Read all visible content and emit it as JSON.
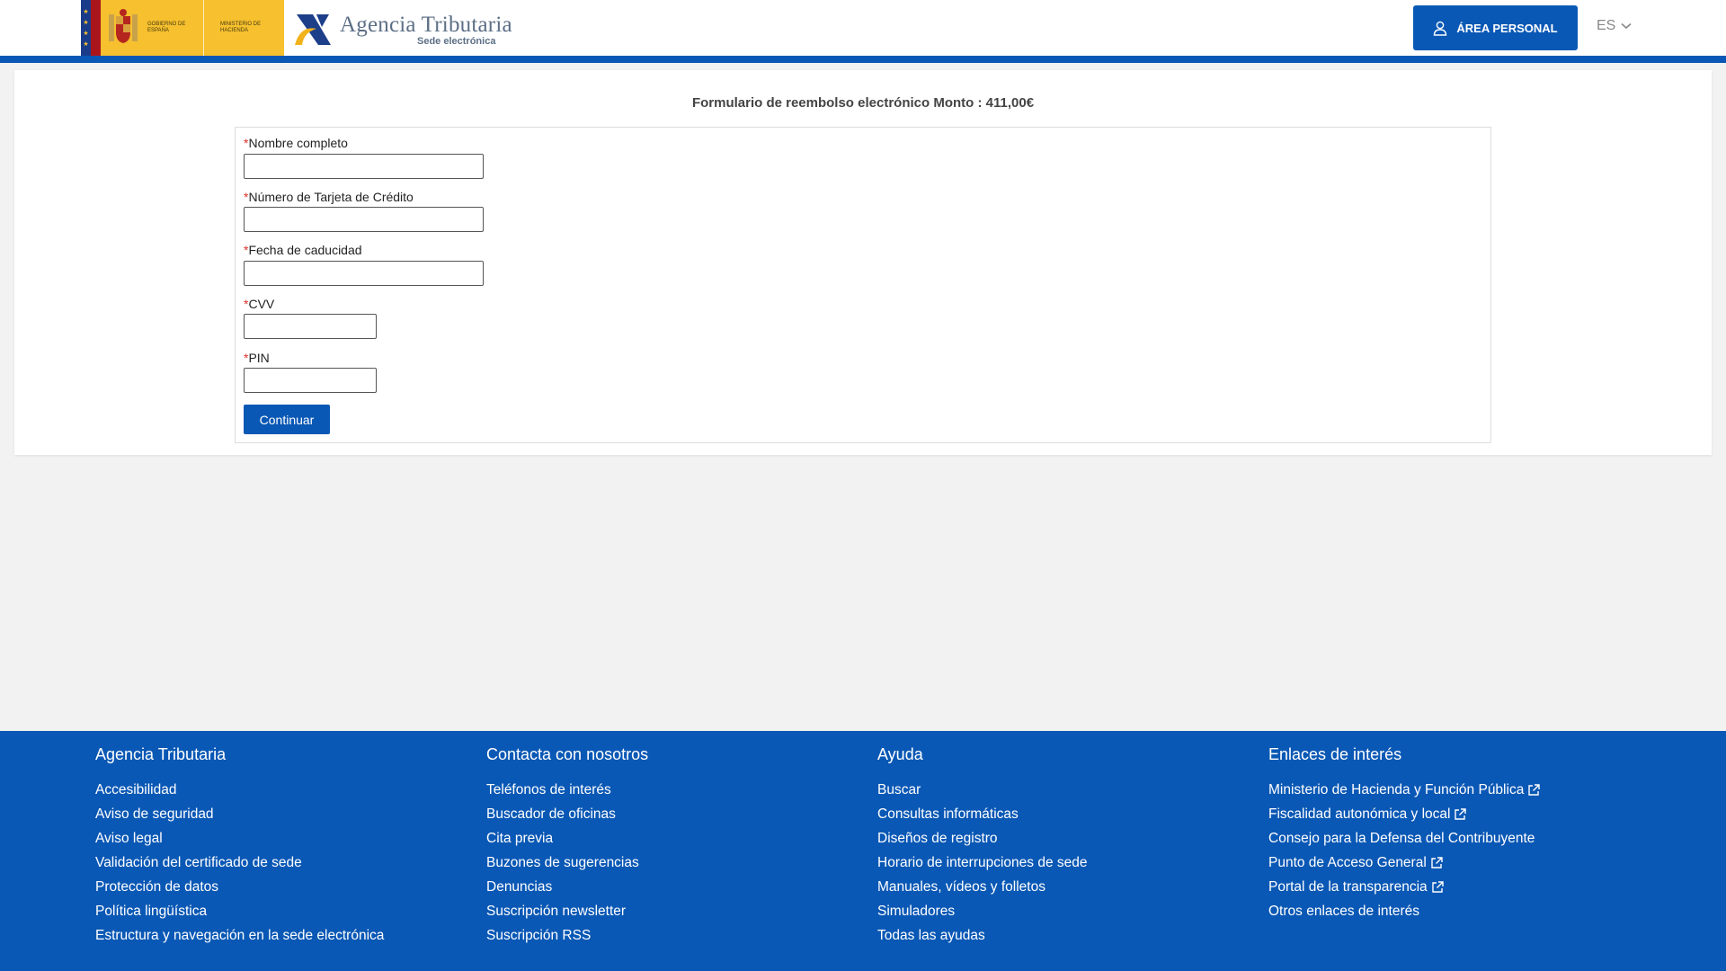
{
  "header": {
    "gobierno_text": "GOBIERNO DE ESPAÑA",
    "ministerio_text": "MINISTERIO DE HACIENDA",
    "agency_name": "Agencia Tributaria",
    "agency_sub": "Sede electrónica",
    "area_personal_label": "ÁREA PERSONAL",
    "language": "ES"
  },
  "form": {
    "title": "Formulario de reembolso electrónico Monto : 411,00€",
    "required_mark": "*",
    "fields": [
      {
        "label": "Nombre completo",
        "value": ""
      },
      {
        "label": "Número de Tarjeta de Crédito",
        "value": ""
      },
      {
        "label": "Fecha de caducidad",
        "value": ""
      },
      {
        "label": "CVV",
        "value": ""
      },
      {
        "label": "PIN",
        "value": ""
      }
    ],
    "submit_label": "Continuar"
  },
  "footer": {
    "columns": [
      {
        "title": "Agencia Tributaria",
        "links": [
          {
            "label": "Accesibilidad",
            "external": false
          },
          {
            "label": "Aviso de seguridad",
            "external": false
          },
          {
            "label": "Aviso legal",
            "external": false
          },
          {
            "label": "Validación del certificado de sede",
            "external": false
          },
          {
            "label": "Protección de datos",
            "external": false
          },
          {
            "label": "Política lingüística",
            "external": false
          },
          {
            "label": "Estructura y navegación en la sede electrónica",
            "external": false
          }
        ]
      },
      {
        "title": "Contacta con nosotros",
        "links": [
          {
            "label": "Teléfonos de interés",
            "external": false
          },
          {
            "label": "Buscador de oficinas",
            "external": false
          },
          {
            "label": "Cita previa",
            "external": false
          },
          {
            "label": "Buzones de sugerencias",
            "external": false
          },
          {
            "label": "Denuncias",
            "external": false
          },
          {
            "label": "Suscripción newsletter",
            "external": false
          },
          {
            "label": "Suscripción RSS",
            "external": false
          }
        ]
      },
      {
        "title": "Ayuda",
        "links": [
          {
            "label": "Buscar",
            "external": false
          },
          {
            "label": "Consultas informáticas",
            "external": false
          },
          {
            "label": "Diseños de registro",
            "external": false
          },
          {
            "label": "Horario de interrupciones de sede",
            "external": false
          },
          {
            "label": "Manuales, vídeos y folletos",
            "external": false
          },
          {
            "label": "Simuladores",
            "external": false
          },
          {
            "label": "Todas las ayudas",
            "external": false
          }
        ]
      },
      {
        "title": "Enlaces de interés",
        "links": [
          {
            "label": "Ministerio de Hacienda y Función Pública",
            "external": true
          },
          {
            "label": "Fiscalidad autonómica y local",
            "external": true
          },
          {
            "label": "Consejo para la Defensa del Contribuyente",
            "external": false
          },
          {
            "label": "Punto de Acceso General",
            "external": true
          },
          {
            "label": "Portal de la transparencia",
            "external": true
          },
          {
            "label": "Otros enlaces de interés",
            "external": false
          }
        ]
      }
    ]
  },
  "colors": {
    "brand_blue": "#0a58b5",
    "required_red": "#d9342b",
    "gob_yellow": "#f6c02e"
  }
}
